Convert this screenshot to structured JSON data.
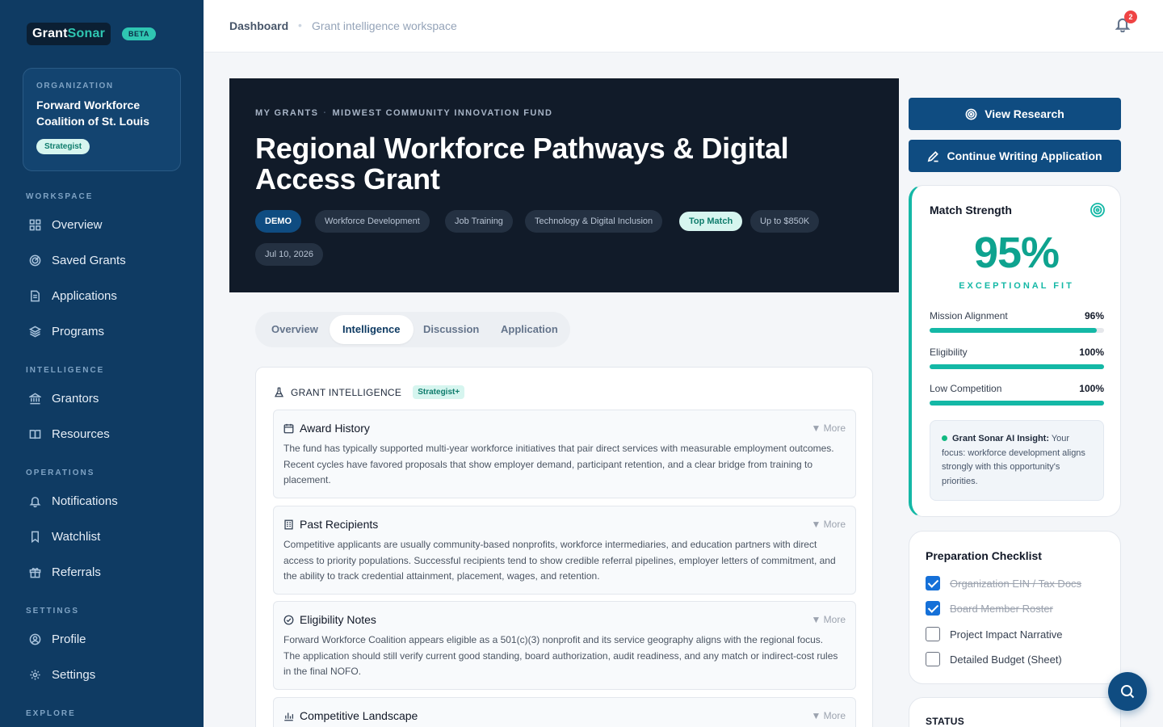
{
  "brand": {
    "name_part1": "Grant",
    "name_part2": "Sonar",
    "badge": "BETA"
  },
  "organization": {
    "kicker": "ORGANIZATION",
    "name": "Forward Workforce Coalition of St. Louis",
    "plan": "Strategist"
  },
  "sidebar": {
    "sections": [
      {
        "title": "WORKSPACE",
        "items": [
          {
            "label": "Overview",
            "icon": "grid-icon"
          },
          {
            "label": "Saved Grants",
            "icon": "radar-icon"
          },
          {
            "label": "Applications",
            "icon": "document-icon"
          },
          {
            "label": "Programs",
            "icon": "layers-icon"
          }
        ]
      },
      {
        "title": "INTELLIGENCE",
        "items": [
          {
            "label": "Grantors",
            "icon": "bank-icon"
          },
          {
            "label": "Resources",
            "icon": "book-icon"
          }
        ]
      },
      {
        "title": "OPERATIONS",
        "items": [
          {
            "label": "Notifications",
            "icon": "bell-icon"
          },
          {
            "label": "Watchlist",
            "icon": "bookmark-icon"
          },
          {
            "label": "Referrals",
            "icon": "gift-icon"
          }
        ]
      },
      {
        "title": "SETTINGS",
        "items": [
          {
            "label": "Profile",
            "icon": "user-icon"
          },
          {
            "label": "Settings",
            "icon": "gear-icon"
          }
        ]
      },
      {
        "title": "EXPLORE",
        "items": []
      }
    ]
  },
  "topbar": {
    "breadcrumb_main": "Dashboard",
    "breadcrumb_sub": "Grant intelligence workspace",
    "notification_count": "2"
  },
  "hero": {
    "crumb_1": "MY GRANTS",
    "crumb_2": "MIDWEST COMMUNITY INNOVATION FUND",
    "title": "Regional Workforce Pathways & Digital Access Grant",
    "tags": [
      "DEMO",
      "Workforce Development",
      "Job Training",
      "Technology & Digital Inclusion",
      "Top Match",
      "Up to $850K",
      "Jul 10, 2026"
    ]
  },
  "tabs": [
    "Overview",
    "Intelligence",
    "Discussion",
    "Application"
  ],
  "active_tab": "Intelligence",
  "intelligence": {
    "title": "GRANT INTELLIGENCE",
    "badge": "Strategist+",
    "more_label": "▼ More",
    "items": [
      {
        "title": "Award History",
        "icon": "calendar-icon",
        "body": "The fund has typically supported multi-year workforce initiatives that pair direct services with measurable employment outcomes. Recent cycles have favored proposals that show employer demand, participant retention, and a clear bridge from training to placement."
      },
      {
        "title": "Past Recipients",
        "icon": "building-icon",
        "body": "Competitive applicants are usually community-based nonprofits, workforce intermediaries, and education partners with direct access to priority populations. Successful recipients tend to show credible referral pipelines, employer letters of commitment, and the ability to track credential attainment, placement, wages, and retention."
      },
      {
        "title": "Eligibility Notes",
        "icon": "check-circle-icon",
        "body": "Forward Workforce Coalition appears eligible as a 501(c)(3) nonprofit and its service geography aligns with the regional focus. The application should still verify current good standing, board authorization, audit readiness, and any match or indirect-cost rules in the final NOFO."
      },
      {
        "title": "Competitive Landscape",
        "icon": "bar-chart-icon",
        "body": ""
      }
    ]
  },
  "actions": {
    "view_research": "View Research",
    "continue_writing": "Continue Writing Application"
  },
  "match": {
    "title": "Match Strength",
    "percent": "95%",
    "label": "EXCEPTIONAL FIT",
    "metrics": [
      {
        "name": "Mission Alignment",
        "value": "96%",
        "fraction": 0.96
      },
      {
        "name": "Eligibility",
        "value": "100%",
        "fraction": 1.0
      },
      {
        "name": "Low Competition",
        "value": "100%",
        "fraction": 1.0
      }
    ],
    "insight_label": "Grant Sonar AI Insight:",
    "insight_text": "Your focus: workforce development aligns strongly with this opportunity's priorities."
  },
  "checklist": {
    "title": "Preparation Checklist",
    "items": [
      {
        "label": "Organization EIN / Tax Docs",
        "checked": true
      },
      {
        "label": "Board Member Roster",
        "checked": true
      },
      {
        "label": "Project Impact Narrative",
        "checked": false
      },
      {
        "label": "Detailed Budget (Sheet)",
        "checked": false
      }
    ]
  },
  "status": {
    "title": "STATUS"
  },
  "colors": {
    "sidebar": "#0f3b63",
    "accent": "#14b8a6",
    "primary": "#0f4c81",
    "hero": "#111b29"
  }
}
